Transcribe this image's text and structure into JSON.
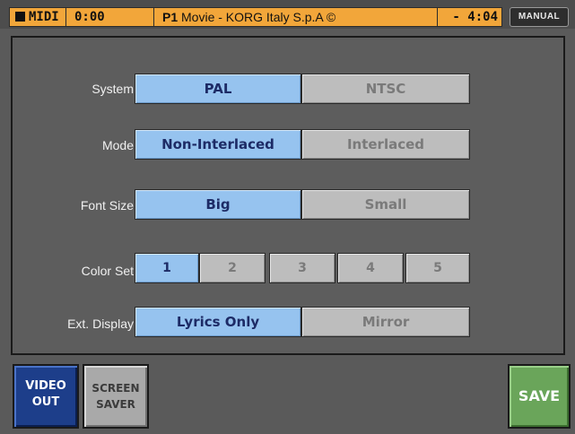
{
  "topbar": {
    "midi_label": "MIDI",
    "time": "0:00",
    "song_prefix": "P1",
    "song_title": "Movie - KORG Italy S.p.A ©",
    "remaining": "- 4:04",
    "mode_button": "MANUAL"
  },
  "settings": {
    "system": {
      "label": "System",
      "options": [
        "PAL",
        "NTSC"
      ],
      "selected": "PAL"
    },
    "mode": {
      "label": "Mode",
      "options": [
        "Non-Interlaced",
        "Interlaced"
      ],
      "selected": "Non-Interlaced"
    },
    "font_size": {
      "label": "Font Size",
      "options": [
        "Big",
        "Small"
      ],
      "selected": "Big"
    },
    "color_set": {
      "label": "Color Set",
      "options": [
        "1",
        "2",
        "3",
        "4",
        "5"
      ],
      "selected": "1"
    },
    "ext_display": {
      "label": "Ext. Display",
      "options": [
        "Lyrics Only",
        "Mirror"
      ],
      "selected": "Lyrics Only"
    }
  },
  "tabs": {
    "video_out": [
      "VIDEO",
      "OUT"
    ],
    "screen_saver": [
      "SCREEN",
      "SAVER"
    ]
  },
  "save_label": "SAVE",
  "colors": {
    "header_orange": "#f2a63a",
    "active_button": "#96c3ef",
    "inactive_button": "#bdbdbd",
    "save_green": "#6aa55a",
    "tab_blue": "#1d3e8a"
  }
}
